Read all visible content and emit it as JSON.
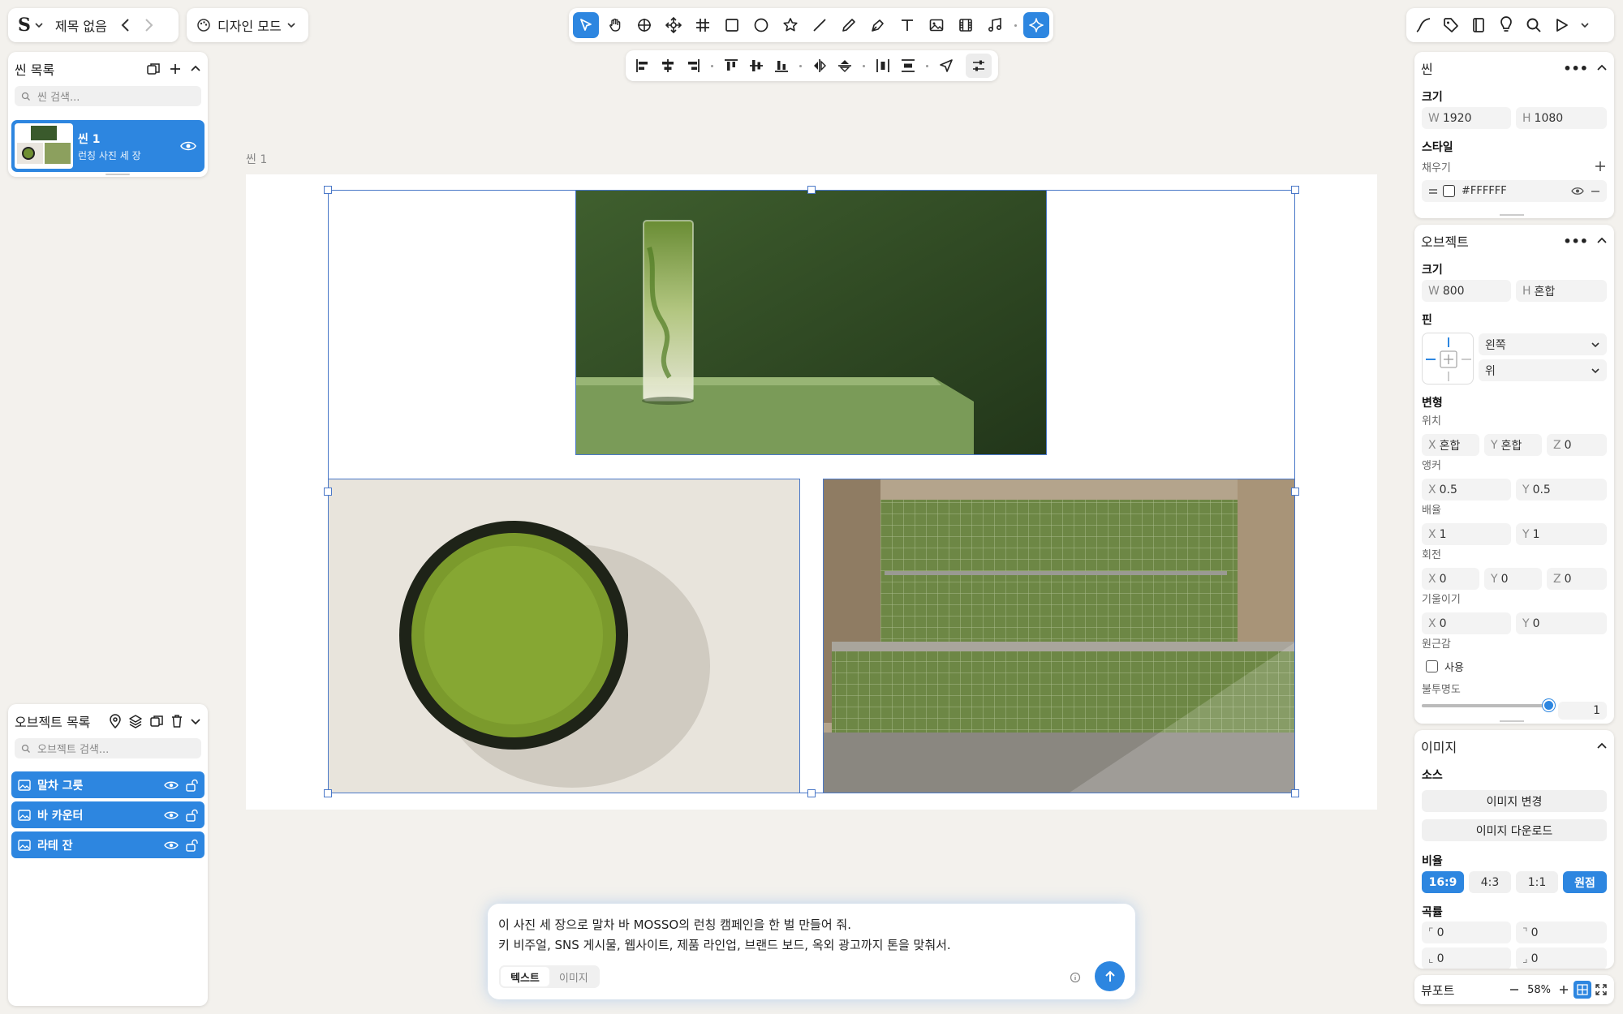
{
  "topbar": {
    "logo_label": "S",
    "title": "제목 없음",
    "mode_label": "디자인 모드"
  },
  "scene_panel": {
    "title": "씬 목록",
    "search_placeholder": "씬 검색...",
    "scene": {
      "name": "씬 1",
      "desc": "런칭 사진 세 장"
    }
  },
  "object_panel": {
    "title": "오브젝트 목록",
    "search_placeholder": "오브젝트 검색...",
    "items": [
      {
        "label": "말차 그릇"
      },
      {
        "label": "바 카운터"
      },
      {
        "label": "라테 잔"
      }
    ]
  },
  "canvas": {
    "scene_label": "씬 1"
  },
  "prompt": {
    "line1": "이 사진 세 장으로 말차 바 MOSSO의 런칭 캠페인을 한 벌 만들어 줘.",
    "line2": "키 비주얼, SNS 게시물, 웹사이트, 제품 라인업, 브랜드 보드, 옥외 광고까지 톤을 맞춰서.",
    "tab_text": "텍스트",
    "tab_image": "이미지"
  },
  "props": {
    "scene": {
      "title": "씬",
      "size_label": "크기",
      "w": "1920",
      "h": "1080",
      "style_label": "스타일",
      "fill_label": "채우기",
      "fill_value": "#FFFFFF"
    },
    "object": {
      "title": "오브젝트",
      "size_label": "크기",
      "w": "800",
      "h": "혼합",
      "pin_label": "핀",
      "pin_h": "왼쪽",
      "pin_v": "위",
      "transform_label": "변형",
      "position_label": "위치",
      "pos_x": "혼합",
      "pos_y": "혼합",
      "pos_z": "0",
      "anchor_label": "앵커",
      "anchor_x": "0.5",
      "anchor_y": "0.5",
      "scale_label": "배율",
      "scale_x": "1",
      "scale_y": "1",
      "rotation_label": "회전",
      "rot_x": "0",
      "rot_y": "0",
      "rot_z": "0",
      "skew_label": "기울이기",
      "skew_x": "0",
      "skew_y": "0",
      "perspective_label": "원근감",
      "perspective_use": "사용",
      "opacity_label": "불투명도",
      "opacity_value": "1"
    },
    "image": {
      "title": "이미지",
      "source_label": "소스",
      "change_btn": "이미지 변경",
      "download_btn": "이미지 다운로드",
      "ratio_label": "비율",
      "ratios": [
        "16:9",
        "4:3",
        "1:1",
        "원점"
      ],
      "radius_label": "곡률",
      "r_tl": "0",
      "r_tr": "0",
      "r_bl": "0",
      "r_br": "0"
    },
    "viewport": {
      "label": "뷰포트",
      "zoom": "58%"
    }
  },
  "axis_letters": {
    "x": "X",
    "y": "Y",
    "z": "Z",
    "w": "W",
    "h": "H"
  },
  "colors": {
    "accent": "#2d86e0",
    "canvas_bg": "#f3f1ed",
    "matcha_dark": "#2f4a25",
    "matcha_light": "#7fa041"
  }
}
